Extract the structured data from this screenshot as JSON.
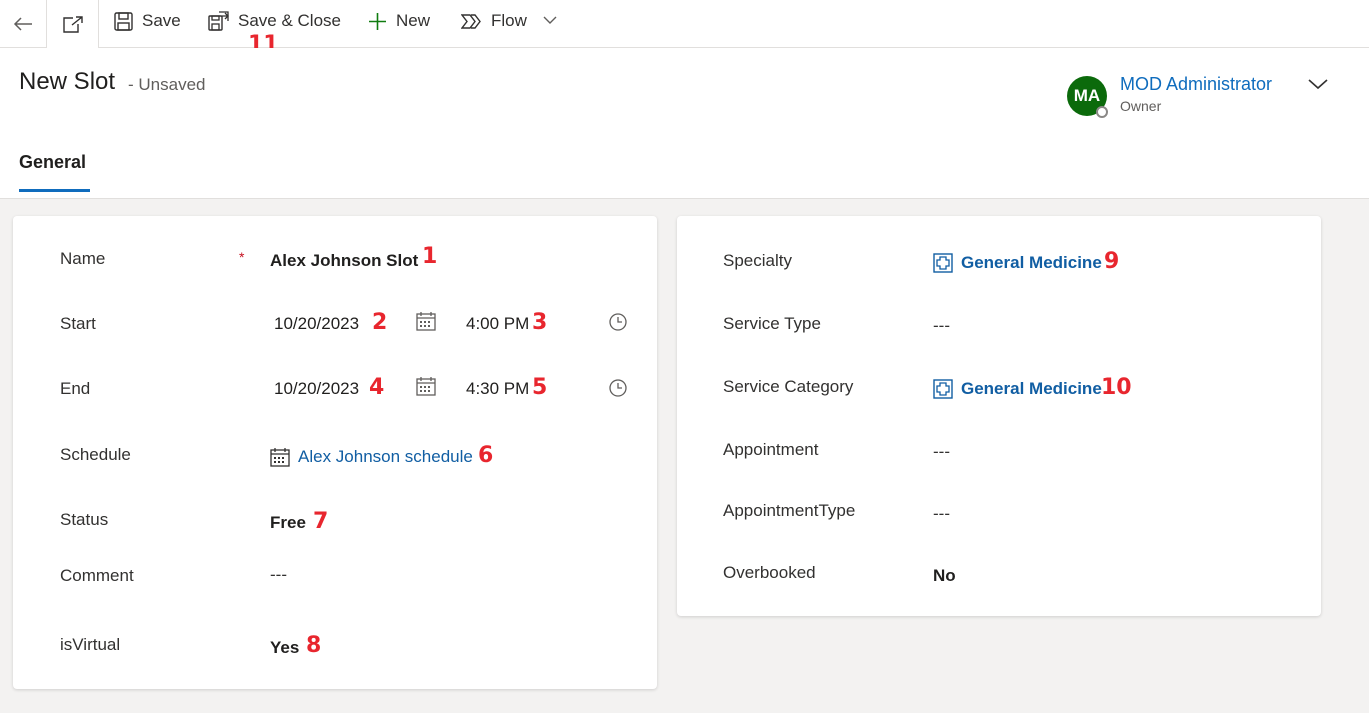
{
  "toolbar": {
    "save_label": "Save",
    "save_close_label": "Save & Close",
    "new_label": "New",
    "flow_label": "Flow",
    "save_close_callout": "11"
  },
  "header": {
    "title": "New Slot",
    "status": "- Unsaved",
    "owner": {
      "initials": "MA",
      "name": "MOD Administrator",
      "role": "Owner",
      "avatar_color": "#0b6a0b"
    }
  },
  "tabs": [
    {
      "label": "General",
      "active": true
    }
  ],
  "left_section": {
    "name": {
      "label": "Name",
      "required_mark": "*",
      "value": "Alex Johnson Slot",
      "callout": "1"
    },
    "start": {
      "label": "Start",
      "date": "10/20/2023",
      "date_callout": "2",
      "time": "4:00 PM",
      "time_callout": "3"
    },
    "end": {
      "label": "End",
      "date": "10/20/2023",
      "date_callout": "4",
      "time": "4:30 PM",
      "time_callout": "5"
    },
    "schedule": {
      "label": "Schedule",
      "value": "Alex Johnson schedule",
      "callout": "6"
    },
    "status": {
      "label": "Status",
      "value": "Free",
      "callout": "7"
    },
    "comment": {
      "label": "Comment",
      "value": "---"
    },
    "is_virtual": {
      "label": "isVirtual",
      "value": "Yes",
      "callout": "8"
    }
  },
  "right_section": {
    "specialty": {
      "label": "Specialty",
      "value": "General Medicine",
      "callout": "9"
    },
    "service_type": {
      "label": "Service Type",
      "value": "---"
    },
    "service_category": {
      "label": "Service Category",
      "value": "General Medicine",
      "callout": "10"
    },
    "appointment": {
      "label": "Appointment",
      "value": "---"
    },
    "appointment_type": {
      "label": "AppointmentType",
      "value": "---"
    },
    "overbooked": {
      "label": "Overbooked",
      "value": "No"
    }
  },
  "colors": {
    "link": "#115ea3",
    "callout": "#e8262e",
    "accent": "#0f6cbd",
    "required": "#c50f1f"
  }
}
